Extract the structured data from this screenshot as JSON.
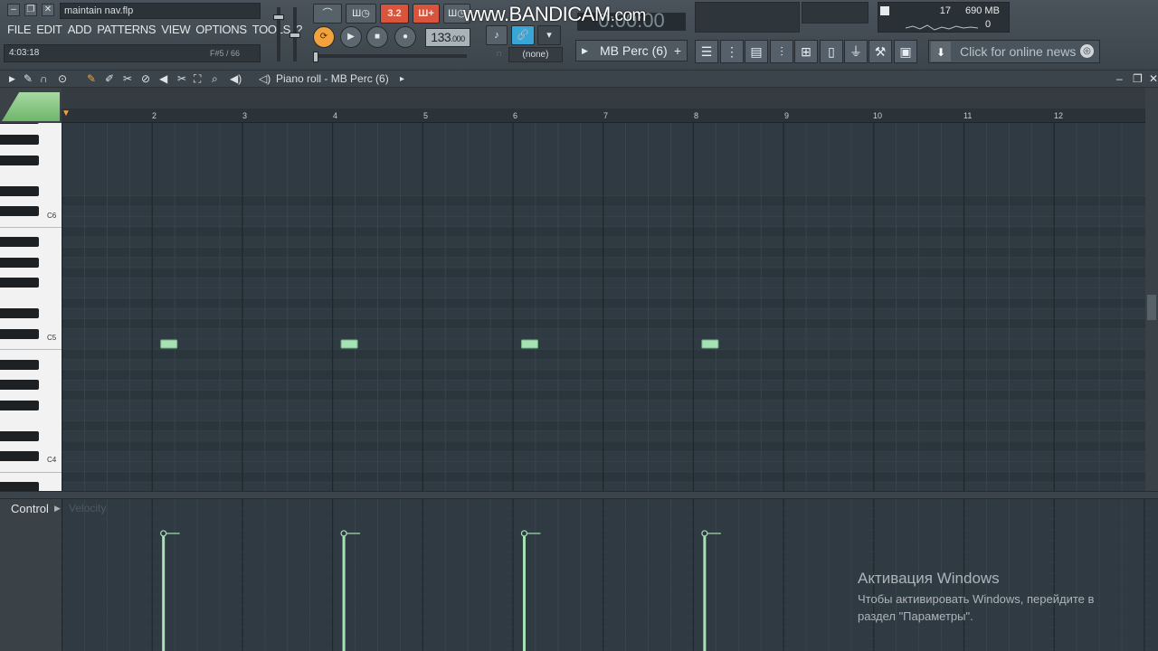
{
  "app": {
    "filename": "maintain nav.flp",
    "menu": [
      "FILE",
      "EDIT",
      "ADD",
      "PATTERNS",
      "VIEW",
      "OPTIONS",
      "TOOLS",
      "?"
    ],
    "hint_time": "4:03:18",
    "hint_note": "F#5 / 66"
  },
  "transport": {
    "tempo": "133",
    "tempo_fraction": ".000",
    "song_position": "0:00:00",
    "snap_value": "3.2",
    "pattern_btn": "Ш",
    "record_target": "(none)",
    "pattern_name": "MB Perc (6)",
    "watermark": "www.BANDICAM",
    "watermark_tld": ".com"
  },
  "meters": {
    "cpu": "17",
    "memory": "690 MB",
    "polyphony": "0"
  },
  "news": {
    "label": "Click for online news"
  },
  "piano_roll": {
    "title": "Piano roll - MB Perc (6)",
    "bars": [
      "2",
      "3",
      "4",
      "5",
      "6",
      "7",
      "8",
      "9",
      "10",
      "11",
      "12"
    ],
    "octaves": [
      "C6",
      "C5",
      "C4"
    ],
    "notes": [
      {
        "bar": 2.1,
        "pitch": "C5",
        "velocity": 0.78
      },
      {
        "bar": 4.1,
        "pitch": "C5",
        "velocity": 0.78
      },
      {
        "bar": 6.1,
        "pitch": "C5",
        "velocity": 0.78
      },
      {
        "bar": 8.1,
        "pitch": "C5",
        "velocity": 0.78
      }
    ]
  },
  "control": {
    "label": "Control",
    "lane": "Velocity"
  },
  "activation": {
    "heading": "Активация Windows",
    "line1": "Чтобы активировать Windows, перейдите в",
    "line2": "раздел \"Параметры\"."
  },
  "colors": {
    "note_fill": "#a7e2b4",
    "grid_bg": "#2f3a42",
    "accent_orange": "#f2a23c",
    "accent_red": "#d8543c",
    "accent_blue": "#39a6d8"
  }
}
